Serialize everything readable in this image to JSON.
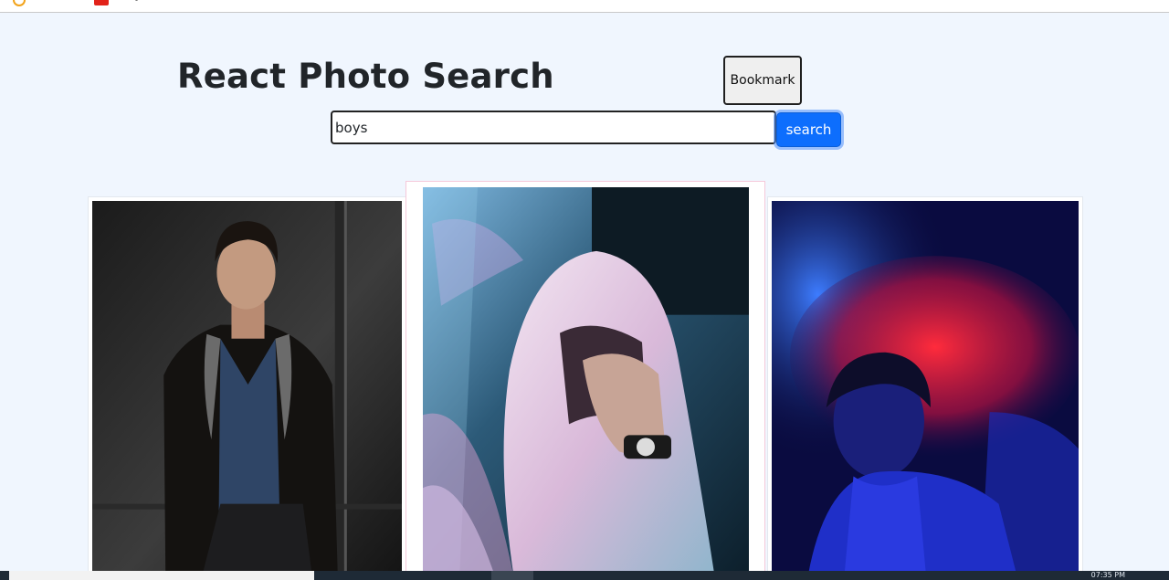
{
  "header": {
    "title": "React Photo Search",
    "bookmark_label": "Bookmark"
  },
  "search": {
    "value": "boys",
    "button_label": "search"
  },
  "photos": [
    {
      "subject": "young man in dark jacket sitting against dark wall"
    },
    {
      "subject": "person in white hoodie with hand on head, neon light"
    },
    {
      "subject": "boy silhouette against red and blue lights"
    }
  ],
  "taskbar": {
    "clock": "07:35 PM"
  },
  "colors": {
    "page_bg": "#f0f6fe",
    "primary_button": "#0d6efd"
  }
}
